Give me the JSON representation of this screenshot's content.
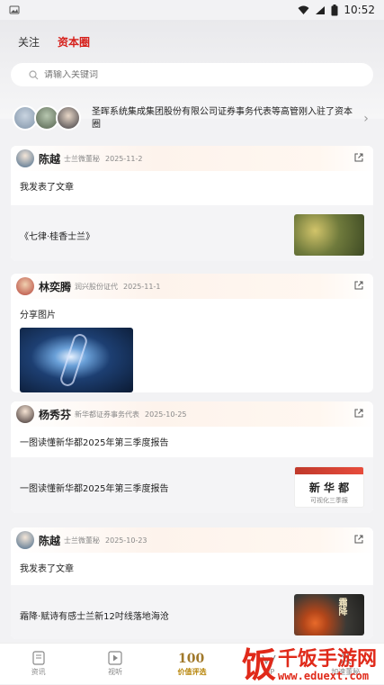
{
  "status": {
    "time": "10:52"
  },
  "tabs": [
    {
      "label": "关注",
      "active": false
    },
    {
      "label": "资本圈",
      "active": true
    }
  ],
  "search": {
    "placeholder": "请输入关键词"
  },
  "notice": {
    "text": "圣晖系统集成集团股份有限公司证券事务代表等高管刚入驻了资本圈"
  },
  "posts": [
    {
      "author": "陈越",
      "role": "士兰微董秘",
      "date": "2025-11-2",
      "text": "我发表了文章",
      "article_title": "《七律·桂香士兰》"
    },
    {
      "author": "林奕腾",
      "role": "润兴股份证代",
      "date": "2025-11-1",
      "text": "分享图片"
    },
    {
      "author": "杨秀芬",
      "role": "新华都证券事务代表",
      "date": "2025-10-25",
      "text": "一图读懂新华都2025年第三季度报告",
      "article_title": "一图读懂新华都2025年第三季度报告",
      "thumb_title": "新 华 都",
      "thumb_sub": "可视化三季报"
    },
    {
      "author": "陈越",
      "role": "士兰微董秘",
      "date": "2025-10-23",
      "text": "我发表了文章",
      "article_title": "霜降·赋诗有感士兰新12吋线落地海沧",
      "thumb_title": "霜降"
    }
  ],
  "nav": [
    {
      "label": "资讯",
      "icon": "news-icon"
    },
    {
      "label": "视听",
      "icon": "play-icon"
    },
    {
      "label": "价值评选",
      "icon": "100-badge-icon"
    },
    {
      "label": "VIP",
      "icon": "vip-icon"
    },
    {
      "label": "加速董秘",
      "icon": "profile-icon"
    }
  ],
  "watermark": {
    "brand": "饭",
    "name": "千饭手游网",
    "url": "www.eduext.com"
  },
  "colors": {
    "accent": "#d6201b",
    "background": "#f2f2f4"
  }
}
